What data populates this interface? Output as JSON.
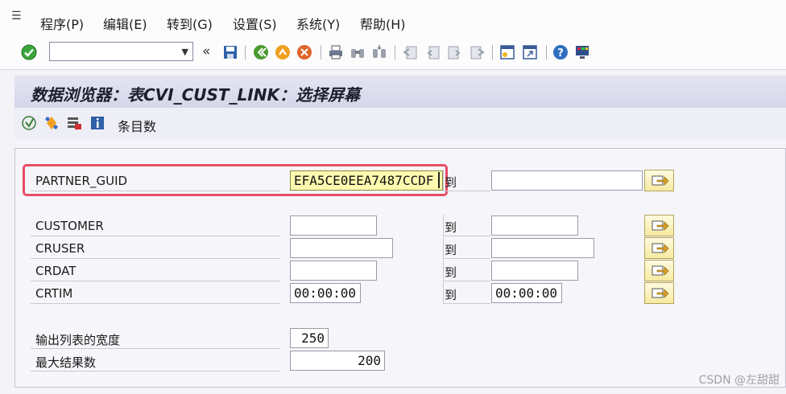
{
  "menu": {
    "items": [
      {
        "label": "程序(P)"
      },
      {
        "label": "编辑(E)"
      },
      {
        "label": "转到(G)"
      },
      {
        "label": "设置(S)"
      },
      {
        "label": "系统(Y)"
      },
      {
        "label": "帮助(H)"
      }
    ]
  },
  "toolbar": {
    "command_value": "",
    "icons": [
      "check-icon",
      "collapse-icon",
      "save-icon",
      "back-icon",
      "exit-icon",
      "cancel-icon",
      "print-icon",
      "find-icon",
      "find-next-icon",
      "first-page-icon",
      "previous-page-icon",
      "next-page-icon",
      "last-page-icon",
      "create-session-icon",
      "shortcut-icon",
      "help-icon",
      "layout-icon"
    ],
    "collapse_glyph": "«"
  },
  "title": "数据浏览器：表CVI_CUST_LINK：选择屏幕",
  "app_toolbar": {
    "entries_label": "条目数"
  },
  "fields": {
    "partner_guid": {
      "label": "PARTNER_GUID",
      "from": "EFA5CE0EEA7487CCDF",
      "to": ""
    },
    "customer": {
      "label": "CUSTOMER",
      "from": "",
      "to": ""
    },
    "cruser": {
      "label": "CRUSER",
      "from": "",
      "to": ""
    },
    "crdat": {
      "label": "CRDAT",
      "from": "",
      "to": ""
    },
    "crtim": {
      "label": "CRTIM",
      "from": "00:00:00",
      "to": "00:00:00"
    },
    "to_label": "到"
  },
  "settings": {
    "width_label": "输出列表的宽度",
    "width_value": "250",
    "max_hits_label": "最大结果数",
    "max_hits_value": "200"
  },
  "watermark": "CSDN @左甜甜",
  "colors": {
    "highlight": "#e64e66",
    "field_active": "#fffab0"
  }
}
